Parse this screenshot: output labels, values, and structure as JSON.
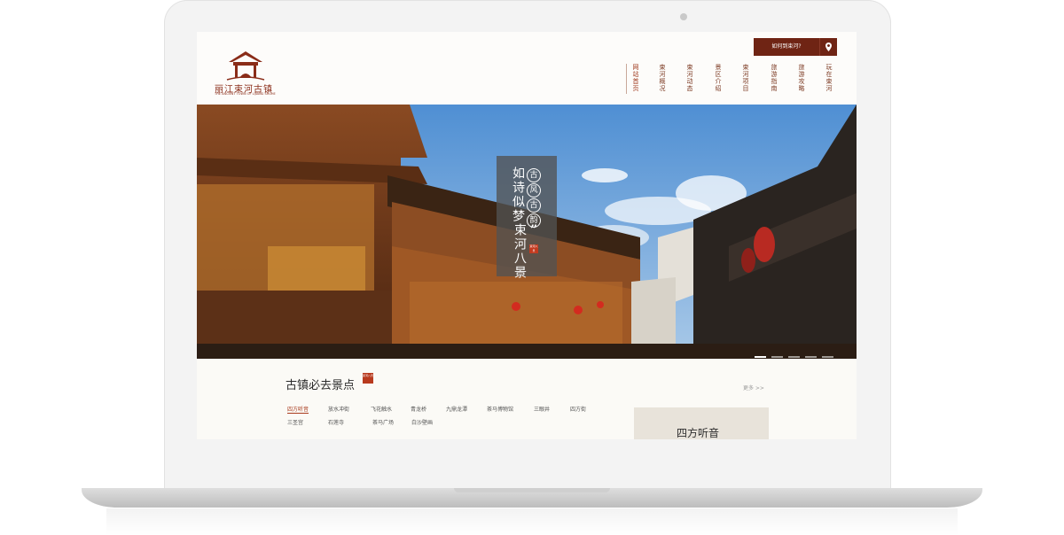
{
  "header": {
    "logo_text": "丽江束河古镇",
    "logo_sub": "THE ANCIENT TOWN OF LIJIANG SHUHE",
    "route_button": "如何到束河?",
    "nav": [
      {
        "label": "网站首页",
        "active": true
      },
      {
        "label": "束河概况",
        "active": false
      },
      {
        "label": "束河动态",
        "active": false
      },
      {
        "label": "景区介绍",
        "active": false
      },
      {
        "label": "束河项目",
        "active": false
      },
      {
        "label": "旅游指南",
        "active": false
      },
      {
        "label": "旅游攻略",
        "active": false
      },
      {
        "label": "玩在束河",
        "active": false
      }
    ]
  },
  "hero": {
    "circle_chars": [
      "古",
      "风",
      "古",
      "韵"
    ],
    "line1": "如诗似梦",
    "quote": "”",
    "line2": "束河八景",
    "stamp": "束河八景",
    "slide_count": 5,
    "active_slide": 0
  },
  "section": {
    "title": "古镇必去景点",
    "badge": "束河八景",
    "more": "更多 >>",
    "tabs_row1": [
      "四方听音",
      "放水冲街",
      "飞花触水",
      "青龙桥",
      "九鼎龙潭",
      "茶马博物馆",
      "三眼井",
      "四方街"
    ],
    "tabs_row2": [
      "三圣宫",
      "石莲寺",
      "茶马广场",
      "白沙壁画"
    ],
    "active_tab": "四方听音",
    "spot_label": "四方听音"
  },
  "colors": {
    "brand": "#6f2414",
    "accent": "#a83a1c",
    "stamp_red": "#c23a1f"
  },
  "icons": [
    "location-pin-icon",
    "logo-gate-icon"
  ]
}
